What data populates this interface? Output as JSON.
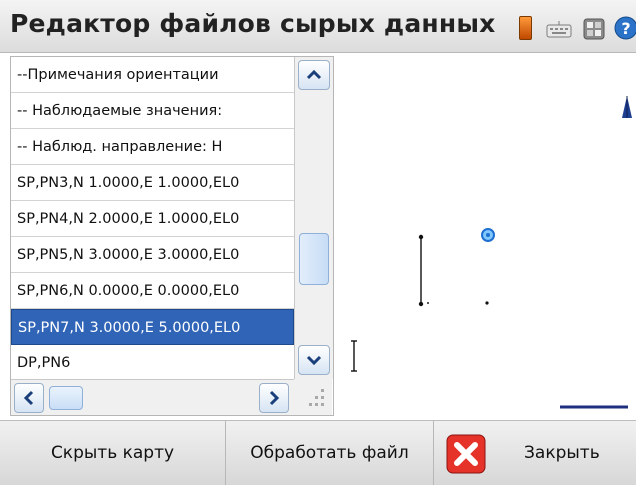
{
  "window": {
    "title": "Редактор файлов сырых данных"
  },
  "status_icons": [
    "battery-icon",
    "keyboard-icon",
    "map-icon",
    "help-icon"
  ],
  "list": {
    "rows": [
      {
        "text": "--Примечания ориентации",
        "selected": false
      },
      {
        "text": "-- Наблюдаемые значения:",
        "selected": false
      },
      {
        "text": "-- Наблюд. направление: Н",
        "selected": false
      },
      {
        "text": "SP,PN3,N 1.0000,E 1.0000,EL0",
        "selected": false
      },
      {
        "text": "SP,PN4,N 2.0000,E 1.0000,EL0",
        "selected": false
      },
      {
        "text": "SP,PN5,N 3.0000,E 3.0000,EL0",
        "selected": false
      },
      {
        "text": "SP,PN6,N 0.0000,E 0.0000,EL0",
        "selected": false
      },
      {
        "text": "SP,PN7,N 3.0000,E 5.0000,EL0",
        "selected": true
      },
      {
        "text": "DP,PN6",
        "selected": false
      }
    ]
  },
  "buttons": {
    "hide_map": "Скрыть карту",
    "process_file": "Обработать файл",
    "close": "Закрыть"
  },
  "colors": {
    "selection": "#2f64b7",
    "map_marker": "#1e6fd0",
    "close_red": "#d8261c"
  }
}
